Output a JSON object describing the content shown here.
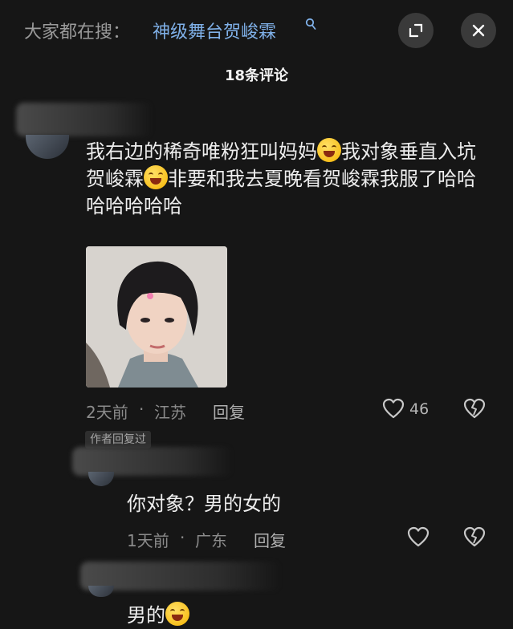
{
  "header": {
    "search_prefix": "大家都在搜：",
    "search_term": "神级舞台贺峻霖",
    "comment_count": "18条评论"
  },
  "comments": [
    {
      "text_part1": "我右边的稀奇唯粉狂叫妈妈",
      "text_part2": "我对象垂直入坑贺峻霖",
      "text_part3": "非要和我去夏晚看贺峻霖我服了哈哈哈哈哈哈哈",
      "time": "2天前",
      "separator": "·",
      "location": "江苏",
      "reply_label": "回复",
      "likes": "46"
    }
  ],
  "replies": [
    {
      "badge": "作者回复过",
      "text": "你对象？男的女的",
      "time": "1天前",
      "separator": "·",
      "location": "广东",
      "reply_label": "回复"
    },
    {
      "text": "男的"
    }
  ],
  "icons": {
    "search_term_icon": "search-icon",
    "expand": "expand-icon",
    "close": "close-icon",
    "like": "heart-outline-icon",
    "dislike": "broken-heart-icon",
    "emoji": "laughing-crying-emoji"
  },
  "colors": {
    "background": "#161616",
    "accent_link": "#7fb0e8",
    "meta_text": "#8b8b8b"
  }
}
